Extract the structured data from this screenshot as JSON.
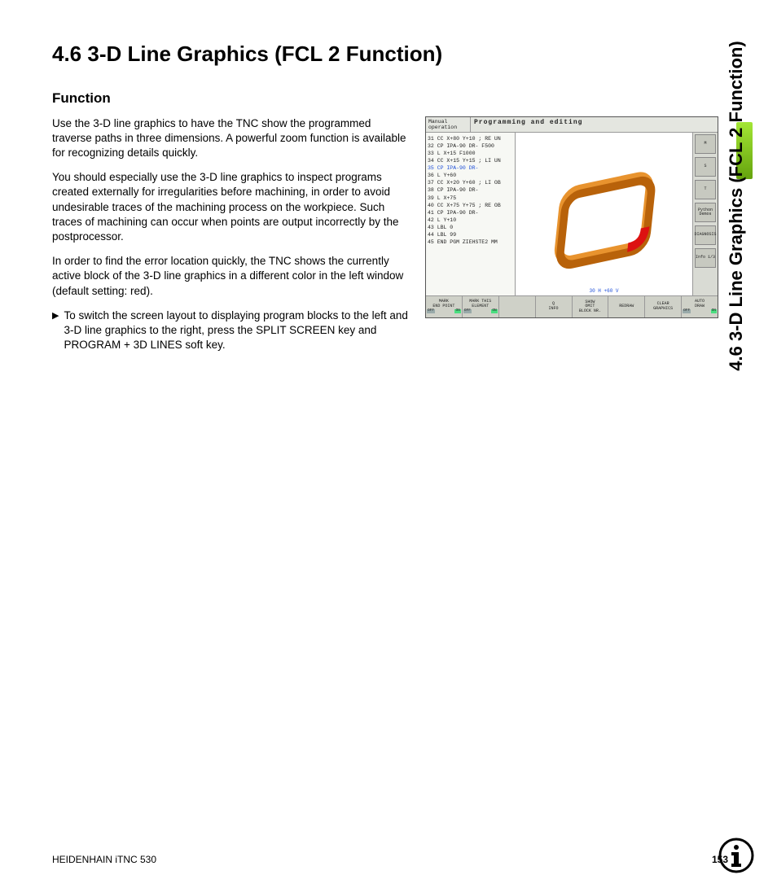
{
  "sideTab": "4.6 3-D Line Graphics (FCL 2 Function)",
  "heading": "4.6 3-D Line Graphics (FCL 2 Function)",
  "subheading": "Function",
  "paragraphs": [
    "Use the 3-D line graphics to have the TNC show the programmed traverse paths in three dimensions. A powerful zoom function is available for recognizing details quickly.",
    "You should especially use the 3-D line graphics to inspect programs created externally for irregularities before machining, in order to avoid undesirable traces of the machining process on the workpiece. Such traces of machining can occur when points are output incorrectly by the postprocessor.",
    "In order to find the error location quickly, the TNC shows the currently active block of the 3-D line graphics in a different color in the left window (default setting: red)."
  ],
  "bullet": "To switch the screen layout to displaying program blocks to the left and 3-D line graphics to the right, press the SPLIT SCREEN key and PROGRAM + 3D LINES soft key.",
  "screenshot": {
    "mode": "Manual operation",
    "title": "Programming and editing",
    "program": [
      "31 CC  X+80  Y+10 ; RE UN",
      "32 CP IPA-90 DR- F500",
      "33 L  X+15 F1000",
      "34 CC  X+15  Y+15 ; LI UN",
      "35 CP IPA-90 DR-",
      "36 L  Y+60",
      "37 CC  X+20  Y+60 ; LI OB",
      "38 CP IPA-90 DR-",
      "39 L  X+75",
      "40 CC  X+75  Y+75 ; RE OB",
      "41 CP IPA-90 DR-",
      "42 L  Y+10",
      "43 LBL 0",
      "44 LBL 99",
      "45 END PGM ZIEHSTE2 MM"
    ],
    "activeLineIndex": 4,
    "status3d": "30 H +60 V",
    "rightButtons": [
      "M",
      "S",
      "T",
      "Python Demos",
      "DIAGNOSIS",
      "Info 1/3"
    ],
    "softkeys": [
      {
        "l1": "MARK",
        "l2": "END POINT",
        "toggle": [
          "OFF",
          "ON"
        ]
      },
      {
        "l1": "MARK THIS",
        "l2": "ELEMENT",
        "toggle": [
          "OFF",
          "ON"
        ]
      },
      {
        "l1": "",
        "l2": ""
      },
      {
        "l1": "Q",
        "l2": "INFO"
      },
      {
        "l1": "SHOW",
        "l2": "OMIT",
        "l3": "BLOCK NR."
      },
      {
        "l1": "REDRAW",
        "l2": ""
      },
      {
        "l1": "CLEAR",
        "l2": "GRAPHICS"
      },
      {
        "l1": "AUTO",
        "l2": "DRAW",
        "toggle": [
          "OFF",
          "ON"
        ]
      }
    ]
  },
  "footer": {
    "left": "HEIDENHAIN iTNC 530",
    "page": "153"
  }
}
